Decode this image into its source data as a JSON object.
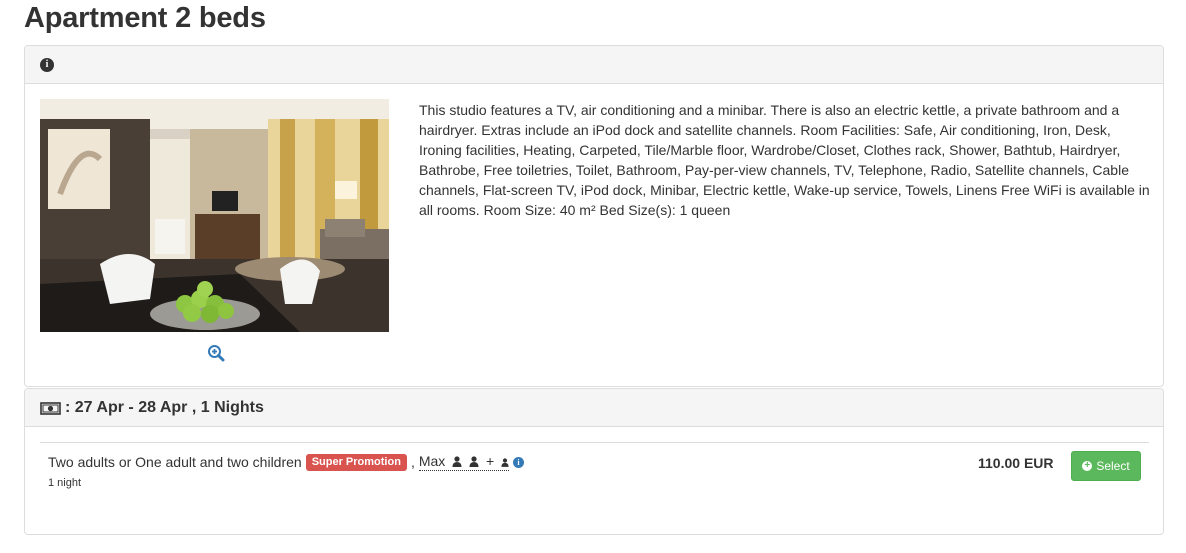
{
  "page": {
    "title": "Apartment 2 beds"
  },
  "room_info": {
    "info_icon": "info-circle-icon",
    "photo_alt": "room photo",
    "zoom_icon": "zoom-in-icon",
    "description": "This studio features a TV, air conditioning and a minibar. There is also an electric kettle, a private bathroom and a hairdryer. Extras include an iPod dock and satellite channels. Room Facilities: Safe, Air conditioning, Iron, Desk, Ironing facilities, Heating, Carpeted, Tile/Marble floor, Wardrobe/Closet, Clothes rack, Shower, Bathtub, Hairdryer, Bathrobe, Free toiletries, Toilet, Bathroom, Pay-per-view channels, TV, Telephone, Radio, Satellite channels, Cable channels, Flat-screen TV, iPod dock, Minibar, Electric kettle, Wake-up service, Towels, Linens Free WiFi is available in all rooms. Room Size: 40 m² Bed Size(s): 1 queen"
  },
  "rates": {
    "dates_text": ": 27 Apr - 28 Apr , 1 Nights",
    "money_icon": "money-icon",
    "items": [
      {
        "occupancy": "Two adults or One adult and two children",
        "promo_badge": "Super Promotion",
        "separator": ",",
        "max_label": "Max",
        "plus": "+",
        "nights": "1 night",
        "price": "110.00 EUR",
        "select_label": "Select"
      }
    ]
  },
  "colors": {
    "promo": "#d9534f",
    "select": "#5cb85c",
    "info_link": "#337ab7",
    "panel_heading": "#f5f5f5"
  }
}
